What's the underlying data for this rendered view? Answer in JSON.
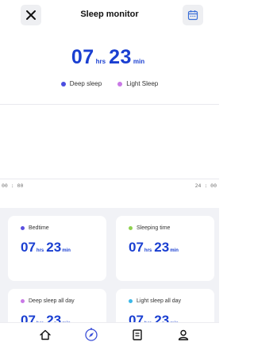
{
  "header": {
    "title": "Sleep monitor",
    "close_icon": "close-icon",
    "calendar_icon": "calendar-icon"
  },
  "total": {
    "hours": "07",
    "hrs_unit": "hrs",
    "minutes": "23",
    "min_unit": "min"
  },
  "legend": [
    {
      "label": "Deep sleep",
      "color": "#4b4ee0"
    },
    {
      "label": "Light Sleep",
      "color": "#c979e6"
    }
  ],
  "chart": {
    "x_start": "00 : 00",
    "x_end": "24 : 00"
  },
  "cards": [
    {
      "label": "Bedtime",
      "color": "#5a4fe0",
      "hours": "07",
      "hrs_unit": "hrs",
      "minutes": "23",
      "min_unit": "min"
    },
    {
      "label": "Sleeping time",
      "color": "#8fd14f",
      "hours": "07",
      "hrs_unit": "hrs",
      "minutes": "23",
      "min_unit": "min"
    },
    {
      "label": "Deep sleep all day",
      "color": "#c979e6",
      "hours": "07",
      "hrs_unit": "hrs",
      "minutes": "23",
      "min_unit": "min"
    },
    {
      "label": "Light sleep all day",
      "color": "#3cb8e8",
      "hours": "07",
      "hrs_unit": "hrs",
      "minutes": "23",
      "min_unit": "min"
    }
  ],
  "tabs": [
    {
      "icon": "home-icon"
    },
    {
      "icon": "compass-icon",
      "active": true
    },
    {
      "icon": "document-icon"
    },
    {
      "icon": "profile-icon"
    }
  ],
  "colors": {
    "accent": "#1a3fd1",
    "active_tab": "#3b4fd8",
    "card_bg": "#f1f2f6"
  }
}
